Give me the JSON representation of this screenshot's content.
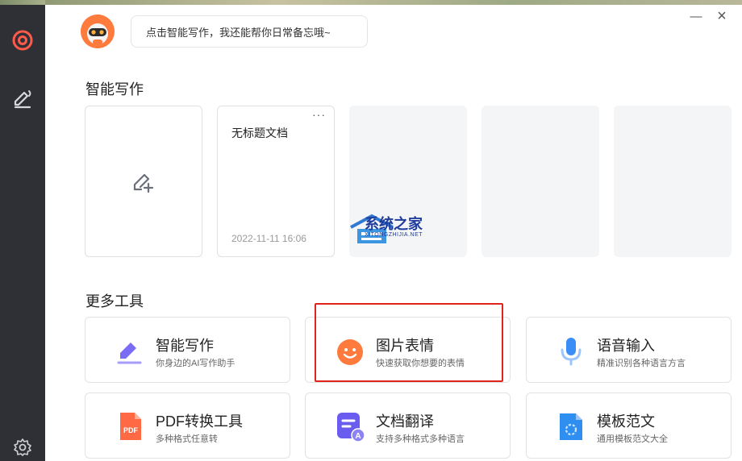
{
  "assistant": {
    "bubble_text": "点击智能写作，我还能帮你日常备忘哦~"
  },
  "sidebar": {
    "items": [
      {
        "icon": "target-icon",
        "active": true
      },
      {
        "icon": "pen-edit-icon",
        "active": false
      },
      {
        "icon": "gear-icon",
        "active": false
      }
    ]
  },
  "window": {
    "minimize_glyph": "—",
    "close_glyph": "×"
  },
  "smart_writing": {
    "section_title": "智能写作",
    "documents": [
      {
        "title": "无标题文档",
        "date": "2022-11-11 16:06",
        "menu_glyph": "···"
      }
    ]
  },
  "more_tools": {
    "section_title": "更多工具",
    "tools": [
      {
        "name": "智能写作",
        "desc": "你身边的AI写作助手",
        "icon": "pen-icon",
        "color": "#7b6cf6"
      },
      {
        "name": "图片表情",
        "desc": "快速获取你想要的表情",
        "icon": "smiley-icon",
        "color": "#ff7a3d"
      },
      {
        "name": "语音输入",
        "desc": "精准识别各种语言方言",
        "icon": "microphone-icon",
        "color": "#3a8ef6"
      },
      {
        "name": "PDF转换工具",
        "desc": "多种格式任意转",
        "icon": "pdf-icon",
        "color": "#ff5a3c"
      },
      {
        "name": "文档翻译",
        "desc": "支持多种格式多种语言",
        "icon": "translate-doc-icon",
        "color": "#6b5cf0"
      },
      {
        "name": "模板范文",
        "desc": "通用模板范文大全",
        "icon": "template-icon",
        "color": "#2f8ff0"
      }
    ]
  },
  "watermark": {
    "title": "系统之家",
    "subtitle": "XITONGZHIJIA.NET"
  },
  "colors": {
    "sidebar_bg": "#2f3035",
    "accent_red": "#e0241b",
    "active_icon": "#ff5a4a"
  }
}
